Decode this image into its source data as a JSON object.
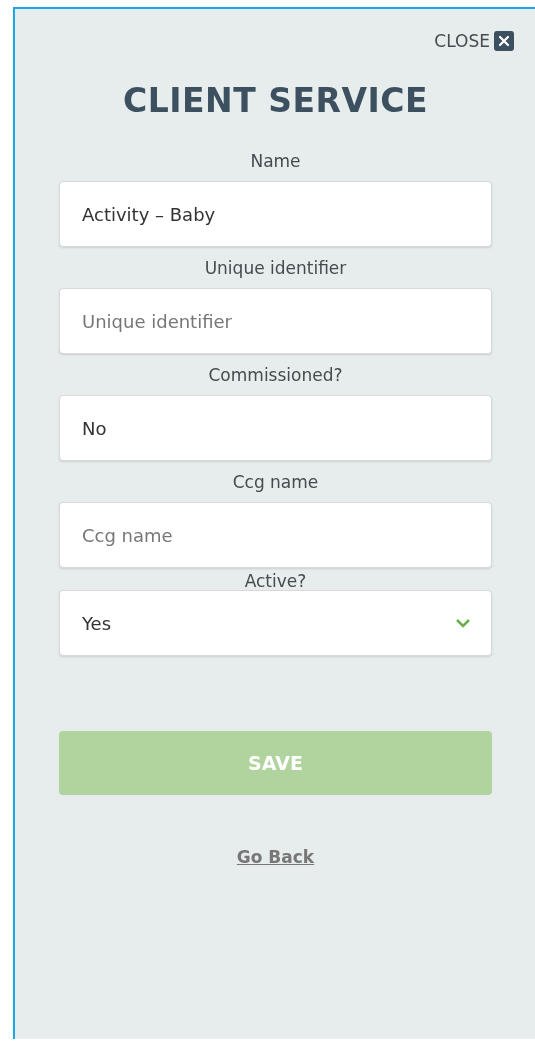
{
  "close": {
    "label": "CLOSE"
  },
  "title": "CLIENT SERVICE",
  "fields": [
    {
      "kind": "text",
      "label": "Name",
      "value": "Activity – Baby"
    },
    {
      "kind": "text",
      "label": "Unique identifier",
      "placeholder": "Unique identifier"
    },
    {
      "kind": "text",
      "label": "Commissioned?",
      "value": "No"
    },
    {
      "kind": "text",
      "label": "Ccg name",
      "placeholder": "Ccg name"
    },
    {
      "kind": "select",
      "label": "Active?",
      "value": "Yes"
    }
  ],
  "save": {
    "label": "SAVE",
    "disabled": true
  },
  "back": {
    "label": "Go Back"
  }
}
